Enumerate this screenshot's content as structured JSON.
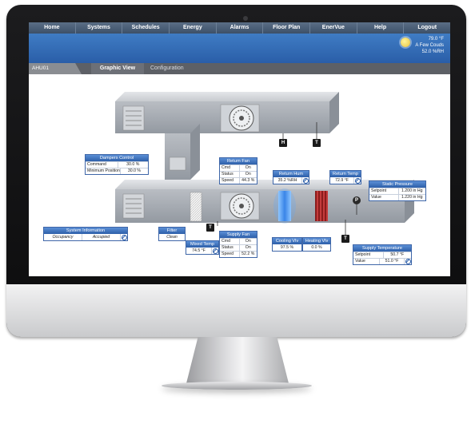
{
  "nav": {
    "items": [
      "Home",
      "Systems",
      "Schedules",
      "Energy",
      "Alarms",
      "Floor Plan",
      "EnerVue",
      "Help",
      "Logout"
    ]
  },
  "weather": {
    "temperature": "79.0 °F",
    "conditions": "A Few Couds",
    "humidity": "52.0 %RH",
    "icon": "partly-cloudy-icon"
  },
  "tabs": {
    "equipment": "AHU01",
    "active": "Graphic View",
    "other": "Configuration"
  },
  "dampers": {
    "title": "Dampers Control",
    "rows": [
      {
        "label": "Command",
        "value": "30.0 %"
      },
      {
        "label": "Minimum Position",
        "value": "30.0 %"
      }
    ]
  },
  "return_fan": {
    "title": "Return Fan",
    "rows": [
      {
        "label": "Cmd",
        "value": "On"
      },
      {
        "label": "Status",
        "value": "On"
      },
      {
        "label": "Speed",
        "value": "44.3 %"
      }
    ]
  },
  "return_hum": {
    "title": "Return Hum",
    "value": "35.2 %RH"
  },
  "return_temp": {
    "title": "Return Temp",
    "value": "72.9 °F"
  },
  "static_pressure": {
    "title": "Static Pressure",
    "rows": [
      {
        "label": "Setpoint",
        "value": "1.200 in Hg"
      },
      {
        "label": "Value",
        "value": "1.220 in Hg"
      }
    ]
  },
  "system_info": {
    "title": "System Information",
    "occupancy": "Occupancy",
    "status": "Accupied"
  },
  "filter": {
    "title": "Filter",
    "value": "Clean"
  },
  "mixed_temp": {
    "title": "Mixed Temp",
    "value": "74.5 °F"
  },
  "supply_fan": {
    "title": "Supply Fan",
    "rows": [
      {
        "label": "Cmd",
        "value": "On"
      },
      {
        "label": "Status",
        "value": "On"
      },
      {
        "label": "Speed",
        "value": "52.2 %"
      }
    ]
  },
  "cooling_vlv": {
    "title": "Cooling Vlv",
    "value": "97.5 %"
  },
  "heating_vlv": {
    "title": "Heating Vlv",
    "value": "0.0 %"
  },
  "supply_temp": {
    "title": "Supply Temperature",
    "rows": [
      {
        "label": "Setpoint",
        "value": "50.7 °F"
      },
      {
        "label": "Value",
        "value": "51.0 °F"
      }
    ]
  },
  "sensors": {
    "humidity": "H",
    "temperature": "T",
    "pressure": "P"
  }
}
